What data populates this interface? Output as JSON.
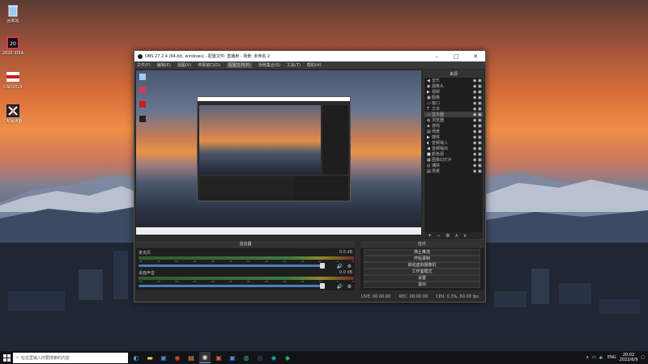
{
  "desktop": {
    "icons": [
      {
        "label": "回收站",
        "icon": "recycle-bin-icon",
        "color": "#9ecbf0"
      },
      {
        "label": "2020 IDEA",
        "icon": "ide-icon",
        "color": "#d23a5a"
      },
      {
        "label": "CAD2014",
        "icon": "cad-icon",
        "color": "#c81e1e"
      },
      {
        "label": "CAJ阅读器",
        "icon": "reader-icon",
        "color": "#222222"
      }
    ]
  },
  "obs": {
    "title": "OBS 27.2.4 (64-bit, windows) - 配置文件: 直播用 - 场景: 未命名 2",
    "menus": [
      "文件(F)",
      "编辑(E)",
      "视图(V)",
      "停靠窗口(D)",
      "配置文件(P)",
      "场景集合(S)",
      "工具(T)",
      "帮助(H)"
    ],
    "selected_menu_index": 4,
    "sources_title": "来源",
    "sources": [
      {
        "name": "音乐",
        "icon": "speaker-icon"
      },
      {
        "name": "摄像头",
        "icon": "camera-icon"
      },
      {
        "name": "视频",
        "icon": "play-icon"
      },
      {
        "name": "图像",
        "icon": "image-icon"
      },
      {
        "name": "窗口",
        "icon": "window-icon"
      },
      {
        "name": "文本",
        "icon": "text-icon"
      },
      {
        "name": "显示器",
        "icon": "monitor-icon",
        "selected": true
      },
      {
        "name": "浏览器",
        "icon": "globe-icon"
      },
      {
        "name": "游戏",
        "icon": "gamepad-icon"
      },
      {
        "name": "场景",
        "icon": "scene-icon"
      },
      {
        "name": "媒体",
        "icon": "play-icon"
      },
      {
        "name": "音频输入",
        "icon": "mic-icon"
      },
      {
        "name": "音频输出",
        "icon": "speaker-icon"
      },
      {
        "name": "颜色源",
        "icon": "color-icon"
      },
      {
        "name": "图像幻灯片",
        "icon": "slideshow-icon"
      },
      {
        "name": "捕获",
        "icon": "capture-icon"
      },
      {
        "name": "场景",
        "icon": "scene-icon"
      }
    ],
    "mixer_title": "混音器",
    "mixer": [
      {
        "name": "麦克风",
        "db": "0.0 dB",
        "fill": 0.96
      },
      {
        "name": "桌面声音",
        "db": "0.0 dB",
        "fill": 0.96
      }
    ],
    "mixer_ticks": [
      "-60",
      "-55",
      "-50",
      "-45",
      "-40",
      "-35",
      "-30",
      "-25",
      "-20",
      "-15",
      "-10",
      "-5",
      "0"
    ],
    "controls_title": "控件",
    "controls": [
      "停止推流",
      "开始录制",
      "启动虚拟摄像机",
      "工作室模式",
      "设置",
      "退出"
    ],
    "status": {
      "live": "LIVE: 00:00:00",
      "rec": "REC: 00:00:00",
      "cpu": "CPU: 0.3%, 60.00 fps"
    }
  },
  "taskbar": {
    "search_placeholder": "在这里输入你要搜索的内容",
    "apps": [
      "edge-icon",
      "folder-icon",
      "store-icon",
      "chrome-icon",
      "notes-icon",
      "obs-icon",
      "wps-icon",
      "photo-icon",
      "wechat-icon",
      "steam-icon",
      "app-icon",
      "app2-icon"
    ],
    "active_app_index": 5,
    "lang": "ENG",
    "time": "20:02",
    "date": "2022/6/9"
  },
  "colors": {
    "accent": "#4a7fbd",
    "obs_bg": "#2b2b2b",
    "dock_bg": "#1e1e1e"
  }
}
